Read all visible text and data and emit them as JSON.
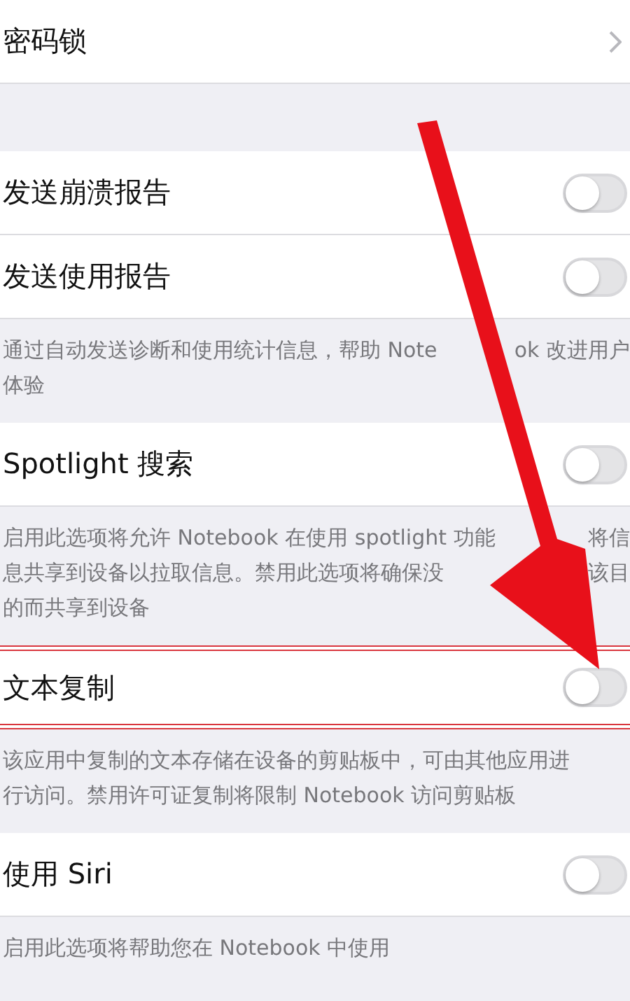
{
  "sections": [
    {
      "rows": [
        {
          "kind": "link",
          "label": "密码锁",
          "highlighted": false
        }
      ]
    },
    {
      "rows": [
        {
          "kind": "toggle",
          "label": "发送崩溃报告",
          "on": false,
          "highlighted": false
        },
        {
          "kind": "toggle",
          "label": "发送使用报告",
          "on": false,
          "highlighted": false
        }
      ],
      "footer": [
        [
          "通过自动发送诊断和使用统计信息，帮助 Note",
          "ok 改进用户"
        ],
        [
          "体验"
        ]
      ]
    },
    {
      "rows": [
        {
          "kind": "toggle",
          "label": "Spotlight 搜索",
          "on": false,
          "highlighted": false
        }
      ],
      "footer": [
        [
          "启用此选项将允许 Notebook 在使用 spotlight 功能",
          "将信"
        ],
        [
          "息共享到设备以拉取信息。禁用此选项将确保没",
          "该目"
        ],
        [
          "的而共享到设备"
        ]
      ]
    },
    {
      "rows": [
        {
          "kind": "toggle",
          "label": "文本复制",
          "on": false,
          "highlighted": true
        }
      ],
      "footer": [
        [
          "该应用中复制的文本存储在设备的剪贴板中，可由其他应用进"
        ],
        [
          "行访问。禁用许可证复制将限制 Notebook 访问剪贴板"
        ]
      ]
    },
    {
      "rows": [
        {
          "kind": "toggle",
          "label": "使用 Siri",
          "on": false,
          "highlighted": false
        }
      ],
      "footer": [
        [
          "启用此选项将帮助您在 Notebook 中使用"
        ]
      ]
    }
  ],
  "annotation": {
    "kind": "arrow"
  }
}
